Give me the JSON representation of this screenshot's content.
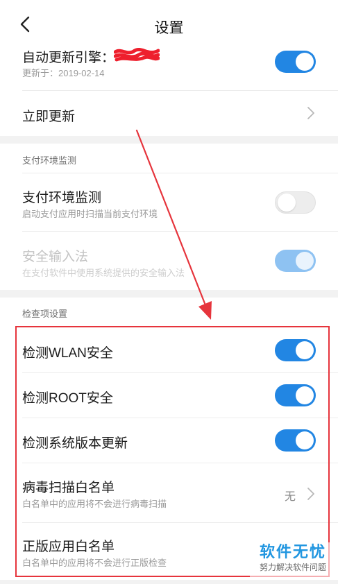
{
  "header": {
    "title": "设置",
    "back_icon": "chevron-left-icon"
  },
  "auto_update": {
    "title": "自动更新引擎：",
    "updated_on": "更新于：2019-02-14",
    "toggle_state": "on"
  },
  "update_now": {
    "title": "立即更新",
    "chevron_icon": "chevron-right-icon"
  },
  "payment_section": {
    "label": "支付环境监测",
    "items": [
      {
        "title": "支付环境监测",
        "subtitle": "启动支付应用时扫描当前支付环境",
        "toggle_state": "off"
      },
      {
        "title": "安全输入法",
        "subtitle": "在支付软件中使用系统提供的安全输入法",
        "toggle_state": "on-disabled"
      }
    ]
  },
  "check_section": {
    "label": "检查项设置",
    "items": [
      {
        "title": "检测WLAN安全",
        "toggle_state": "on"
      },
      {
        "title": "检测ROOT安全",
        "toggle_state": "on"
      },
      {
        "title": "检测系统版本更新",
        "toggle_state": "on"
      },
      {
        "title": "病毒扫描白名单",
        "subtitle": "白名单中的应用将不会进行病毒扫描",
        "value": "无"
      },
      {
        "title": "正版应用白名单",
        "subtitle": "白名单中的应用将不会进行正版检查"
      }
    ]
  },
  "watermark": {
    "title": "软件无忧",
    "subtitle": "努力解决软件问题"
  },
  "colors": {
    "accent": "#2286e3",
    "annotation_red": "#e6343c",
    "section_bg": "#f2f2f2",
    "watermark_blue": "#2196e0"
  }
}
